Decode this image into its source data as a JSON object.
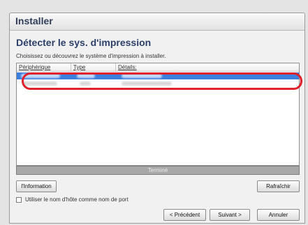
{
  "window": {
    "title": "Installer"
  },
  "page": {
    "heading": "Détecter le sys. d'impression",
    "subtitle": "Choisissez ou découvrez le système d'impression à installer."
  },
  "list": {
    "columns": [
      "Périphérique",
      "Type",
      "Détails:"
    ]
  },
  "status": {
    "text": "Terminé"
  },
  "buttons": {
    "information": "l'Information",
    "refresh": "Rafraîchir",
    "previous": "< Précédent",
    "next": "Suivant >",
    "cancel": "Annuler"
  },
  "options": {
    "use_hostname_label": "Utiliser le nom d'hôte comme nom de port",
    "use_hostname_checked": false
  },
  "colors": {
    "selection": "#3c7fdc",
    "annotation": "#e0202a"
  }
}
